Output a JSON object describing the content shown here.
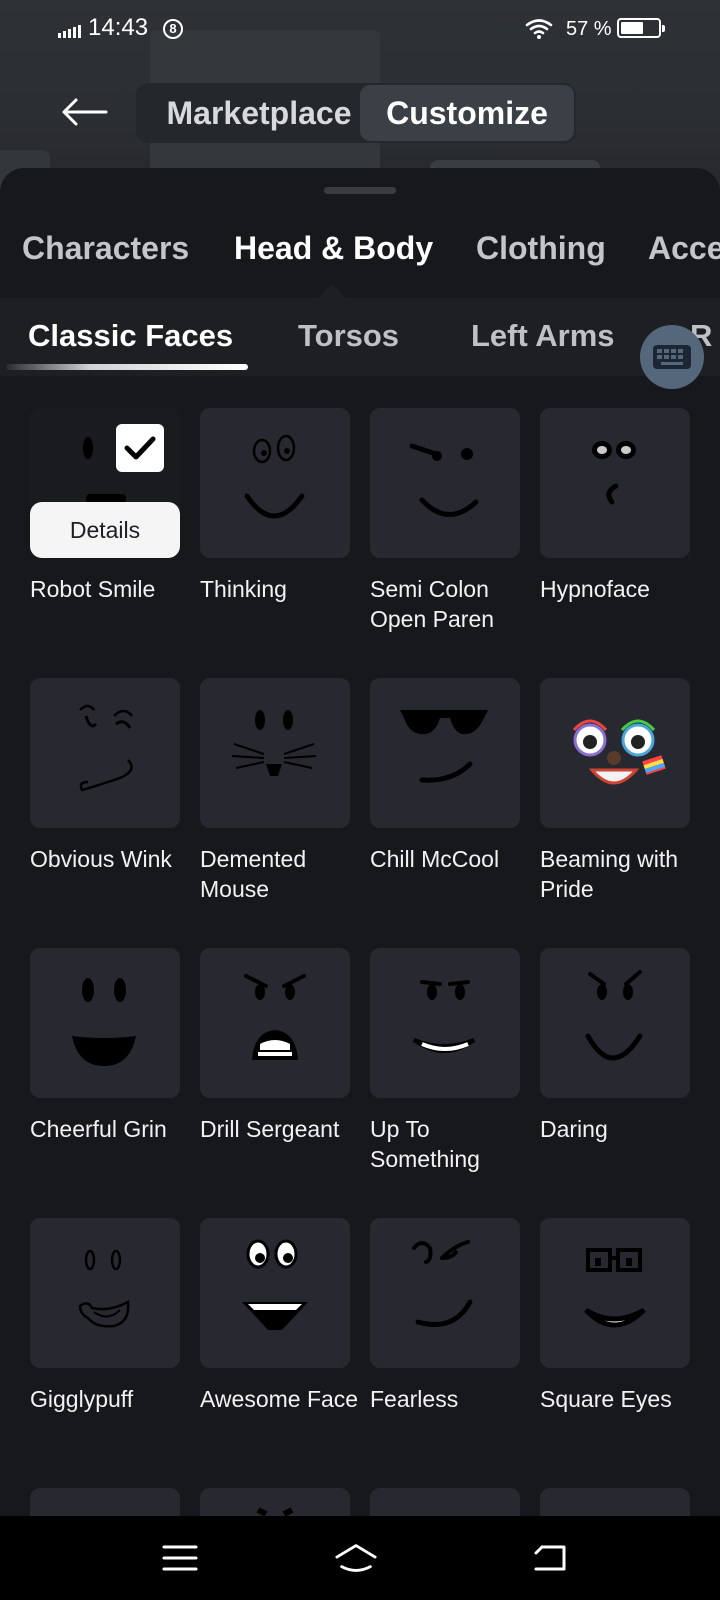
{
  "status_bar": {
    "time": "14:43",
    "notification_count": "8",
    "battery_percent": "57 %",
    "battery_level": 0.57
  },
  "header": {
    "segments": [
      {
        "label": "Marketplace",
        "active": false
      },
      {
        "label": "Customize",
        "active": true
      }
    ]
  },
  "category_tabs": [
    "Characters",
    "Head & Body",
    "Clothing",
    "Acce"
  ],
  "active_category": "Head & Body",
  "sub_tabs": [
    "Classic Faces",
    "Torsos",
    "Left Arms",
    "R"
  ],
  "active_sub_tab": "Classic Faces",
  "items": [
    {
      "name": "Robot Smile",
      "selected": true,
      "details_label": "Details",
      "icon": "robot-smile-face-icon"
    },
    {
      "name": "Thinking",
      "icon": "thinking-face-icon"
    },
    {
      "name": "Semi Colon Open Paren",
      "icon": "semi-colon-face-icon"
    },
    {
      "name": "Hypnoface",
      "icon": "hypnoface-icon"
    },
    {
      "name": "Obvious Wink",
      "icon": "obvious-wink-face-icon"
    },
    {
      "name": "Demented Mouse",
      "icon": "demented-mouse-face-icon"
    },
    {
      "name": "Chill McCool",
      "icon": "chill-mccool-face-icon"
    },
    {
      "name": "Beaming with Pride",
      "icon": "beaming-with-pride-face-icon"
    },
    {
      "name": "Cheerful Grin",
      "icon": "cheerful-grin-face-icon"
    },
    {
      "name": "Drill Sergeant",
      "icon": "drill-sergeant-face-icon"
    },
    {
      "name": "Up To Something",
      "icon": "up-to-something-face-icon"
    },
    {
      "name": "Daring",
      "icon": "daring-face-icon"
    },
    {
      "name": "Gigglypuff",
      "icon": "gigglypuff-face-icon"
    },
    {
      "name": "Awesome Face",
      "icon": "awesome-face-icon"
    },
    {
      "name": "Fearless",
      "icon": "fearless-face-icon"
    },
    {
      "name": "Square Eyes",
      "icon": "square-eyes-face-icon"
    }
  ],
  "colors": {
    "background": "#121215",
    "sheet": "#17181b",
    "tile": "#282930",
    "keyboard_button": "#55677a"
  }
}
